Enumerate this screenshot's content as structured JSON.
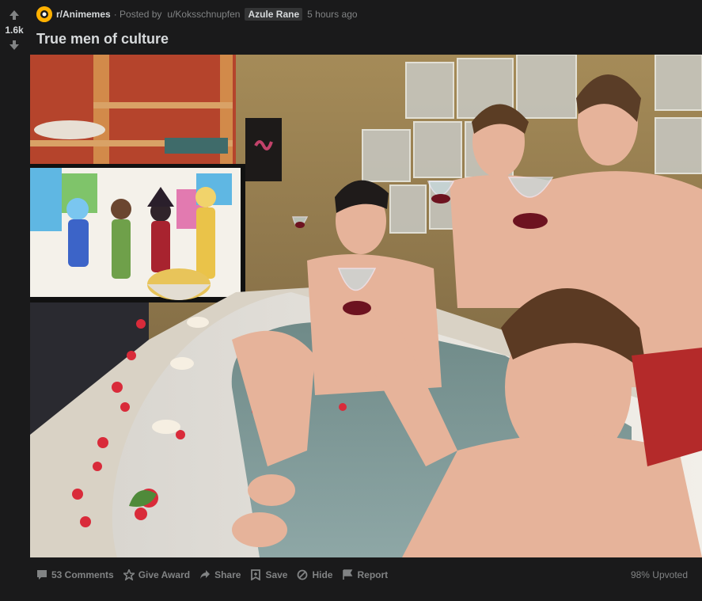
{
  "vote": {
    "score": "1.6k"
  },
  "post": {
    "subreddit": "r/Animemes",
    "posted_by_prefix": "· Posted by",
    "author": "u/Koksschnupfen",
    "flair": "Azule Rane",
    "age": "5 hours ago",
    "title": "True men of culture"
  },
  "actions": {
    "comments": "53 Comments",
    "award": "Give Award",
    "share": "Share",
    "save": "Save",
    "hide": "Hide",
    "report": "Report",
    "upvoted": "98% Upvoted"
  },
  "colors": {
    "background": "#1a1a1b",
    "text": "#d7dadc",
    "muted": "#818384",
    "subreddit_icon": "#ffb000"
  }
}
